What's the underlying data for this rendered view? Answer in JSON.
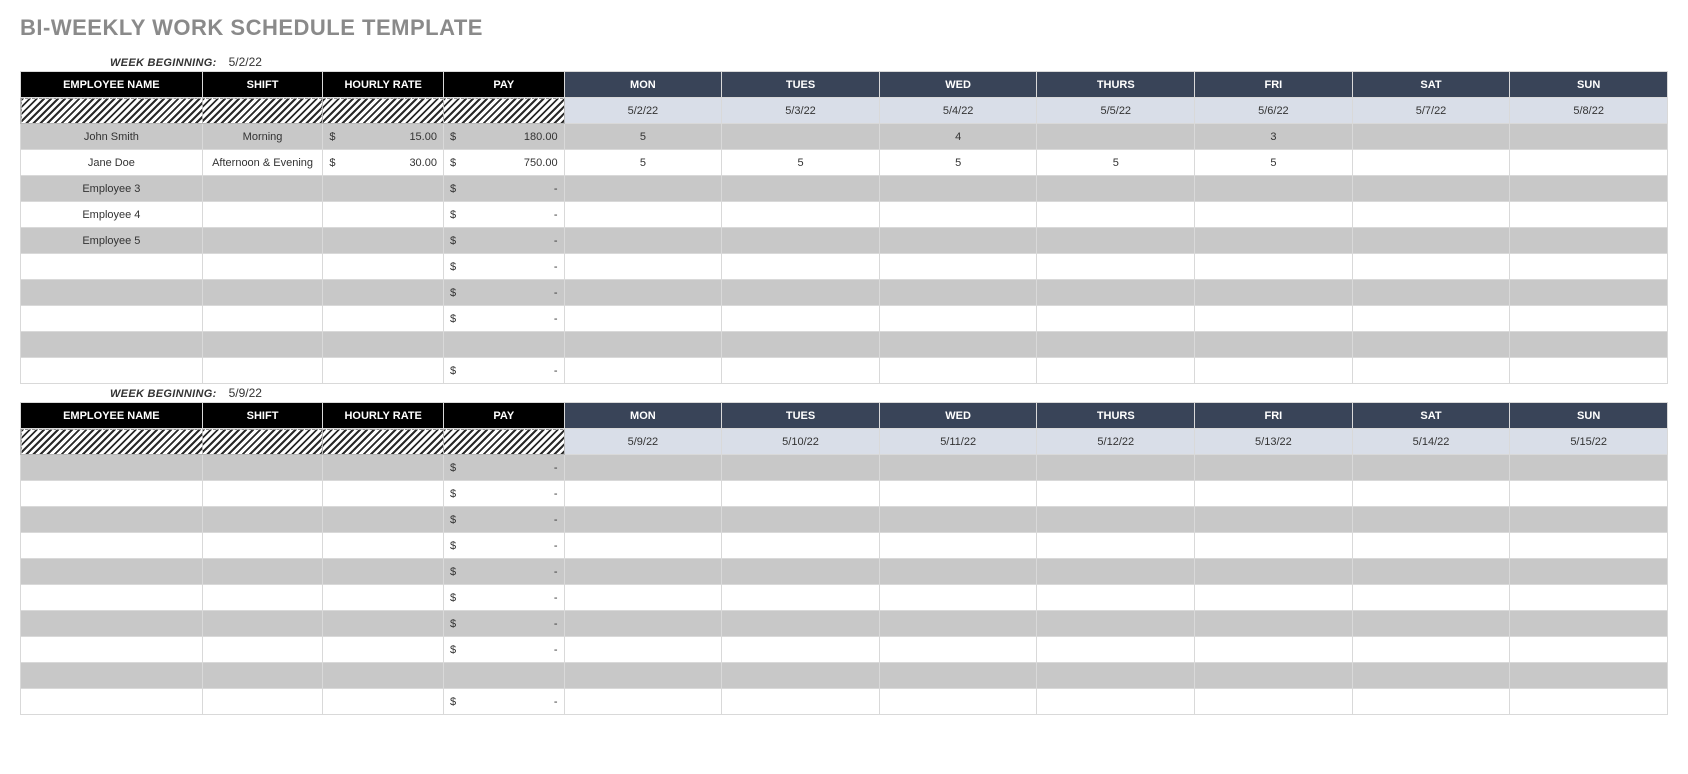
{
  "title": "BI-WEEKLY WORK SCHEDULE TEMPLATE",
  "labels": {
    "week_beginning": "WEEK BEGINNING:",
    "employee_name": "EMPLOYEE NAME",
    "shift": "SHIFT",
    "hourly_rate": "HOURLY RATE",
    "pay": "PAY",
    "days": [
      "MON",
      "TUES",
      "WED",
      "THURS",
      "FRI",
      "SAT",
      "SUN"
    ],
    "dollar": "$",
    "dash": "-"
  },
  "weeks": [
    {
      "beginning": "5/2/22",
      "dates": [
        "5/2/22",
        "5/3/22",
        "5/4/22",
        "5/5/22",
        "5/6/22",
        "5/7/22",
        "5/8/22"
      ],
      "rows": [
        {
          "name": "John Smith",
          "shift": "Morning",
          "rate": "15.00",
          "pay": "180.00",
          "days": [
            "5",
            "",
            "4",
            "",
            "3",
            "",
            ""
          ]
        },
        {
          "name": "Jane Doe",
          "shift": "Afternoon & Evening",
          "rate": "30.00",
          "pay": "750.00",
          "days": [
            "5",
            "5",
            "5",
            "5",
            "5",
            "",
            ""
          ]
        },
        {
          "name": "Employee 3",
          "shift": "",
          "rate": "",
          "pay": "-",
          "days": [
            "",
            "",
            "",
            "",
            "",
            "",
            ""
          ]
        },
        {
          "name": "Employee 4",
          "shift": "",
          "rate": "",
          "pay": "-",
          "days": [
            "",
            "",
            "",
            "",
            "",
            "",
            ""
          ]
        },
        {
          "name": "Employee 5",
          "shift": "",
          "rate": "",
          "pay": "-",
          "days": [
            "",
            "",
            "",
            "",
            "",
            "",
            ""
          ]
        },
        {
          "name": "",
          "shift": "",
          "rate": "",
          "pay": "-",
          "days": [
            "",
            "",
            "",
            "",
            "",
            "",
            ""
          ]
        },
        {
          "name": "",
          "shift": "",
          "rate": "",
          "pay": "-",
          "days": [
            "",
            "",
            "",
            "",
            "",
            "",
            ""
          ]
        },
        {
          "name": "",
          "shift": "",
          "rate": "",
          "pay": "-",
          "days": [
            "",
            "",
            "",
            "",
            "",
            "",
            ""
          ]
        },
        {
          "name": "",
          "shift": "",
          "rate": "",
          "pay": "",
          "days": [
            "",
            "",
            "",
            "",
            "",
            "",
            ""
          ]
        },
        {
          "name": "",
          "shift": "",
          "rate": "",
          "pay": "-",
          "days": [
            "",
            "",
            "",
            "",
            "",
            "",
            ""
          ]
        }
      ]
    },
    {
      "beginning": "5/9/22",
      "dates": [
        "5/9/22",
        "5/10/22",
        "5/11/22",
        "5/12/22",
        "5/13/22",
        "5/14/22",
        "5/15/22"
      ],
      "rows": [
        {
          "name": "",
          "shift": "",
          "rate": "",
          "pay": "-",
          "days": [
            "",
            "",
            "",
            "",
            "",
            "",
            ""
          ]
        },
        {
          "name": "",
          "shift": "",
          "rate": "",
          "pay": "-",
          "days": [
            "",
            "",
            "",
            "",
            "",
            "",
            ""
          ]
        },
        {
          "name": "",
          "shift": "",
          "rate": "",
          "pay": "-",
          "days": [
            "",
            "",
            "",
            "",
            "",
            "",
            ""
          ]
        },
        {
          "name": "",
          "shift": "",
          "rate": "",
          "pay": "-",
          "days": [
            "",
            "",
            "",
            "",
            "",
            "",
            ""
          ]
        },
        {
          "name": "",
          "shift": "",
          "rate": "",
          "pay": "-",
          "days": [
            "",
            "",
            "",
            "",
            "",
            "",
            ""
          ]
        },
        {
          "name": "",
          "shift": "",
          "rate": "",
          "pay": "-",
          "days": [
            "",
            "",
            "",
            "",
            "",
            "",
            ""
          ]
        },
        {
          "name": "",
          "shift": "",
          "rate": "",
          "pay": "-",
          "days": [
            "",
            "",
            "",
            "",
            "",
            "",
            ""
          ]
        },
        {
          "name": "",
          "shift": "",
          "rate": "",
          "pay": "-",
          "days": [
            "",
            "",
            "",
            "",
            "",
            "",
            ""
          ]
        },
        {
          "name": "",
          "shift": "",
          "rate": "",
          "pay": "",
          "days": [
            "",
            "",
            "",
            "",
            "",
            "",
            ""
          ]
        },
        {
          "name": "",
          "shift": "",
          "rate": "",
          "pay": "-",
          "days": [
            "",
            "",
            "",
            "",
            "",
            "",
            ""
          ]
        }
      ]
    }
  ]
}
